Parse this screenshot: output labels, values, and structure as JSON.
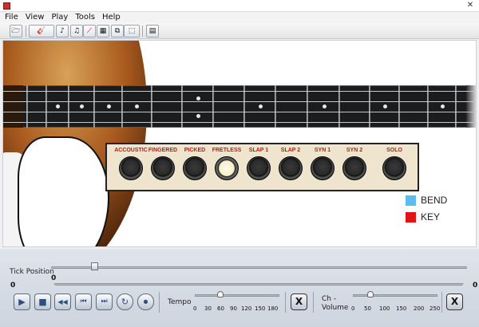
{
  "window": {
    "close_glyph": "✕"
  },
  "menu": [
    "File",
    "View",
    "Play",
    "Tools",
    "Help"
  ],
  "toolbar": {
    "buttons": [
      {
        "name": "open-file-icon",
        "glyph": "🗁"
      },
      {
        "name": "guitar-icon",
        "glyph": "🎸"
      },
      {
        "name": "tuner-icon",
        "glyph": "♪"
      },
      {
        "name": "music-note-icon",
        "glyph": "♫"
      },
      {
        "name": "metronome-icon",
        "glyph": "⟋"
      },
      {
        "name": "grid-icon",
        "glyph": "▦"
      },
      {
        "name": "copy-icon",
        "glyph": "⧉"
      },
      {
        "name": "selection-icon",
        "glyph": "⬚"
      },
      {
        "name": "settings-icon",
        "glyph": "▤"
      }
    ]
  },
  "presets": {
    "items": [
      {
        "label": "ACCOUSTIC",
        "active": false
      },
      {
        "label": "FINGERED",
        "active": false
      },
      {
        "label": "PICKED",
        "active": false
      },
      {
        "label": "FRETLESS",
        "active": true
      },
      {
        "label": "SLAP 1",
        "active": false
      },
      {
        "label": "SLAP 2",
        "active": false
      },
      {
        "label": "SYN 1",
        "active": false
      },
      {
        "label": "SYN 2",
        "active": false
      },
      {
        "label": "SOLO",
        "active": false
      }
    ]
  },
  "legend": {
    "bend_label": "BEND",
    "bend_color": "#5bbcf2",
    "key_label": "KEY",
    "key_color": "#e01414"
  },
  "tick_position": {
    "label": "Tick Position",
    "value": "0"
  },
  "range_slider": {
    "min_label": "0",
    "max_label": "0"
  },
  "transport": {
    "buttons": [
      {
        "name": "play-icon",
        "glyph": "▶"
      },
      {
        "name": "stop-icon",
        "glyph": "■"
      },
      {
        "name": "rewind-icon",
        "glyph": "◀◀"
      },
      {
        "name": "skip-back-icon",
        "glyph": "⏮"
      },
      {
        "name": "skip-forward-icon",
        "glyph": "⏭"
      },
      {
        "name": "loop-icon",
        "glyph": "↻"
      },
      {
        "name": "record-icon",
        "glyph": "⏺"
      }
    ]
  },
  "tempo": {
    "label": "Tempo",
    "ticks": [
      "0",
      "30",
      "60",
      "90",
      "120",
      "150",
      "180"
    ],
    "reset_label": "X"
  },
  "volume": {
    "label_line1": "Ch -",
    "label_line2": "Volume",
    "ticks": [
      "0",
      "50",
      "100",
      "150",
      "200",
      "250"
    ],
    "reset_label": "X"
  }
}
